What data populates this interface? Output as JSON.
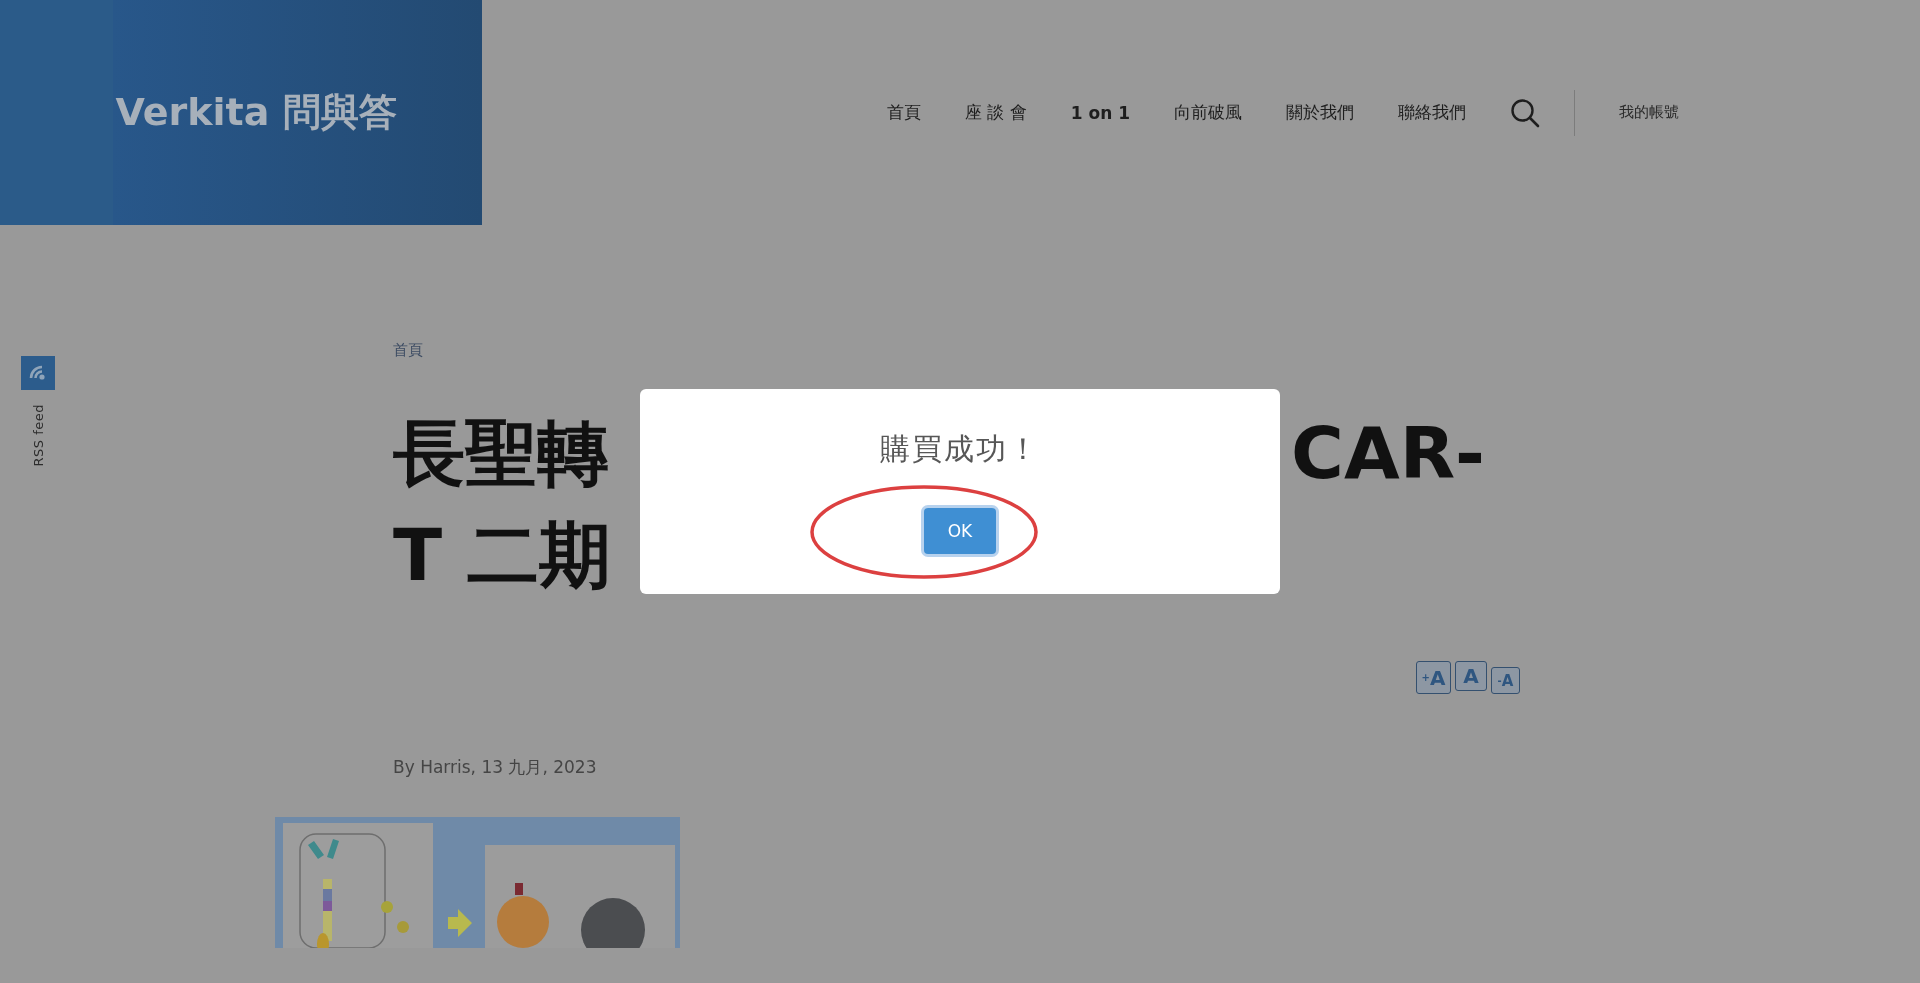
{
  "site": {
    "logo": "Verkita 問與答"
  },
  "nav": {
    "items": [
      {
        "label": "首頁",
        "selected": false
      },
      {
        "label": "座 談 會",
        "selected": false
      },
      {
        "label": "1 on 1",
        "selected": true
      },
      {
        "label": "向前破風",
        "selected": false
      },
      {
        "label": "關於我們",
        "selected": false
      },
      {
        "label": "聯絡我們",
        "selected": false
      }
    ],
    "account": "我的帳號"
  },
  "rss": {
    "label": "RSS feed"
  },
  "article": {
    "breadcrumb": "首頁",
    "title_lines": [
      {
        "left": "長聖轉",
        "right": "CAR-"
      },
      {
        "left": "T 二期"
      }
    ],
    "font_size_buttons": [
      "$^{+}$A",
      "A",
      "$^{-}$A"
    ],
    "byline": "By Harris, 13 九月, 2023"
  },
  "dialog": {
    "title": "購買成功！",
    "button": "OK",
    "highlighted": true
  }
}
